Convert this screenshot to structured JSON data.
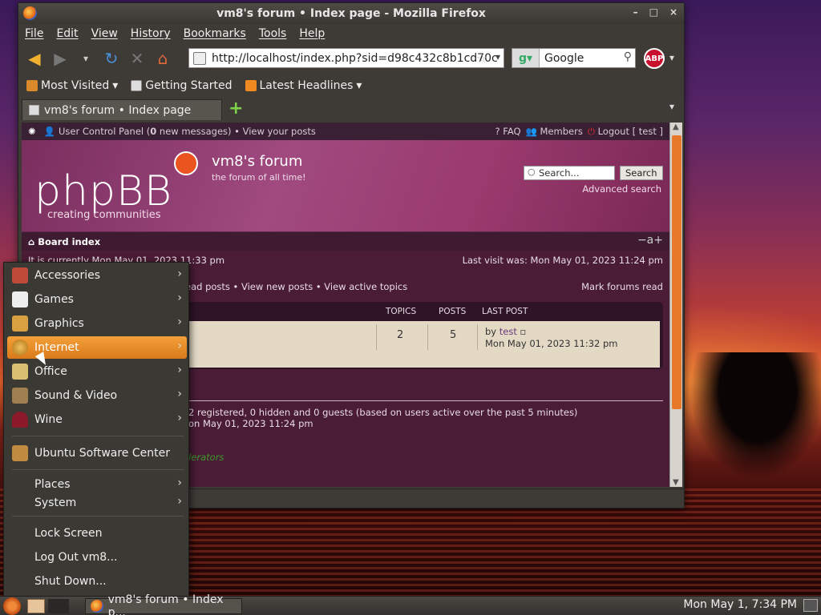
{
  "window": {
    "title": "vm8's forum • Index page - Mozilla Firefox",
    "controls": [
      "–",
      "□",
      "×"
    ]
  },
  "menubar": [
    "File",
    "Edit",
    "View",
    "History",
    "Bookmarks",
    "Tools",
    "Help"
  ],
  "navbar": {
    "url": "http://localhost/index.php?sid=d98c432c8b1cd70c",
    "search_engine_label": "Google",
    "abp_label": "ABP"
  },
  "bookmarks": [
    "Most Visited",
    "Getting Started",
    "Latest Headlines"
  ],
  "tabs": [
    {
      "label": "vm8's forum • Index page"
    }
  ],
  "page": {
    "top_strip": {
      "ucp": "User Control Panel (",
      "msg_count": "0",
      "ucp_tail": " new messages) • View your posts",
      "faq": "FAQ",
      "members": "Members",
      "logout": "Logout [ test ]"
    },
    "header": {
      "logo_text": "phpBB",
      "logo_tagline": "creating communities",
      "site_title": "vm8's forum",
      "site_desc": "the forum of all time!",
      "search_placeholder": "Search...",
      "search_button": "Search",
      "advanced_search": "Advanced search"
    },
    "breadcrumb": "Board index",
    "font_size_icon": "−a+",
    "current_time": "It is currently Mon May 01, 2023 11:33 pm",
    "last_visit": "Last visit was: Mon May 01, 2023 11:24 pm",
    "links_left": "ead posts • View new posts • View active topics",
    "mark_forums_read": "Mark forums read",
    "table": {
      "headers": [
        "TOPICS",
        "POSTS",
        "LAST POST"
      ],
      "row": {
        "topics": "2",
        "posts": "5",
        "lastpost_by": "by ",
        "lastpost_user": "test",
        "lastpost_time": "Mon May 01, 2023 11:32 pm"
      }
    },
    "online_text": "2 registered, 0 hidden and 0 guests (based on users active over the past 5 minutes)",
    "online_text2": "on May 01, 2023 11:24 pm",
    "legend": "derators"
  },
  "app_menu": {
    "items": [
      {
        "label": "Accessories",
        "icon": "accessories-icon",
        "submenu": true
      },
      {
        "label": "Games",
        "icon": "games-icon",
        "submenu": true
      },
      {
        "label": "Graphics",
        "icon": "graphics-icon",
        "submenu": true
      },
      {
        "label": "Internet",
        "icon": "internet-icon",
        "submenu": true,
        "active": true
      },
      {
        "label": "Office",
        "icon": "office-icon",
        "submenu": true
      },
      {
        "label": "Sound & Video",
        "icon": "sound-video-icon",
        "submenu": true
      },
      {
        "label": "Wine",
        "icon": "wine-icon",
        "submenu": true
      },
      {
        "label": "Ubuntu Software Center",
        "icon": "software-center-icon",
        "submenu": false
      },
      {
        "label": "Places",
        "submenu": true
      },
      {
        "label": "System",
        "submenu": true
      },
      {
        "label": "Lock Screen",
        "submenu": false
      },
      {
        "label": "Log Out vm8...",
        "submenu": false
      },
      {
        "label": "Shut Down...",
        "submenu": false
      }
    ]
  },
  "panel": {
    "task_label": "vm8's forum • Index p...",
    "clock": "Mon May  1,  7:34 PM"
  },
  "colors": {
    "accent": "#e8782a",
    "menu_active": "#e58a24",
    "forum_bg": "#4a1c35"
  }
}
